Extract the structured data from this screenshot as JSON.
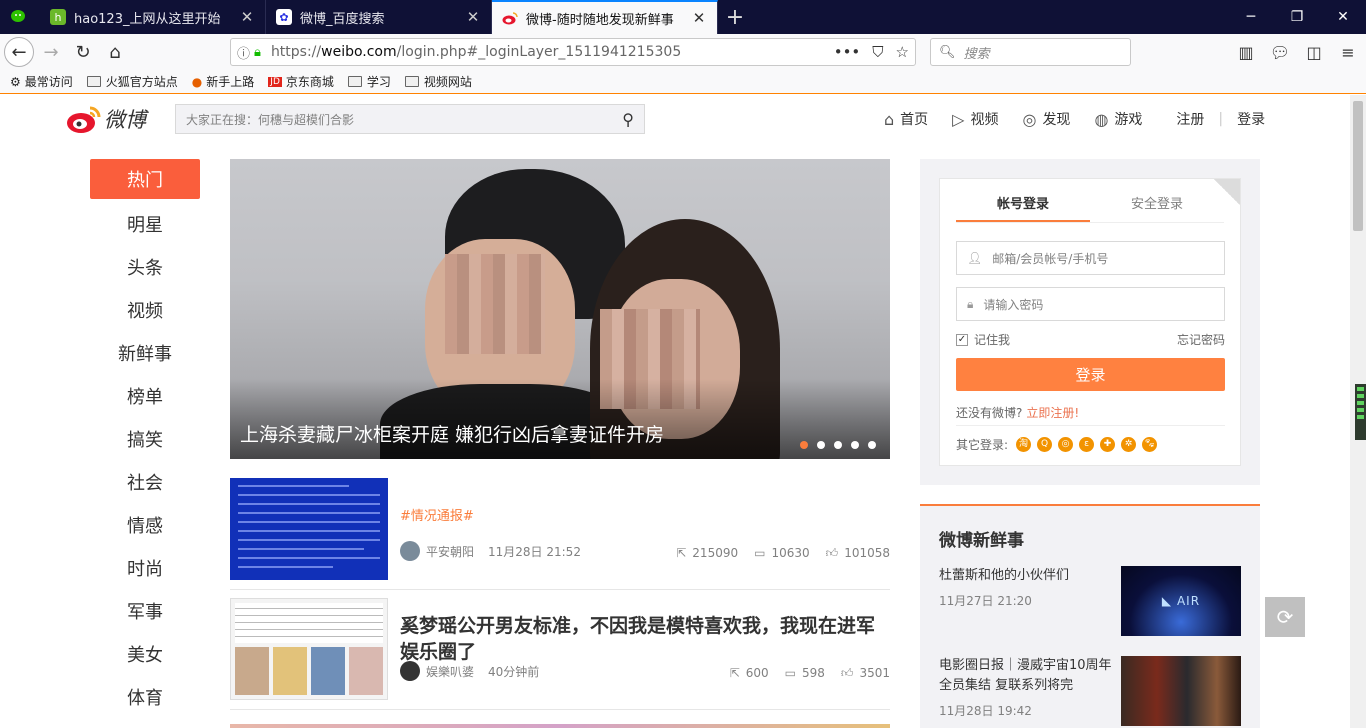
{
  "browser": {
    "tabs": [
      {
        "title": "hao123_上网从这里开始",
        "active": false
      },
      {
        "title": "微博_百度搜索",
        "active": false
      },
      {
        "title": "微博-随时随地发现新鲜事",
        "active": true
      }
    ],
    "url_prefix": "https://",
    "url_domain": "weibo.com",
    "url_path": "/login.php#_loginLayer_1511941215305",
    "search_placeholder": "搜索",
    "bookmarks": [
      "最常访问",
      "火狐官方站点",
      "新手上路",
      "京东商城",
      "学习",
      "视频网站"
    ]
  },
  "header": {
    "logo_text": "微博",
    "search_placeholder": "大家正在搜：何穗与超模们合影",
    "nav": [
      "首页",
      "视频",
      "发现",
      "游戏"
    ],
    "register": "注册",
    "login": "登录"
  },
  "left_nav": [
    "热门",
    "明星",
    "头条",
    "视频",
    "新鲜事",
    "榜单",
    "搞笑",
    "社会",
    "情感",
    "时尚",
    "军事",
    "美女",
    "体育"
  ],
  "hero": {
    "caption": "上海杀妻藏尸冰柜案开庭 嫌犯行凶后拿妻证件开房",
    "slides": 5,
    "active_slide": 0
  },
  "feed": [
    {
      "tag": "#情况通报#",
      "author": "平安朝阳",
      "time": "11月28日 21:52",
      "reposts": "215090",
      "comments": "10630",
      "likes": "101058"
    },
    {
      "headline": "奚梦瑶公开男友标准，不因我是模特喜欢我，我现在进军娱乐圈了",
      "author": "娱樂叭婆",
      "time": "40分钟前",
      "reposts": "600",
      "comments": "598",
      "likes": "3501"
    }
  ],
  "login": {
    "tab_account": "帐号登录",
    "tab_secure": "安全登录",
    "username_placeholder": "邮箱/会员帐号/手机号",
    "password_placeholder": "请输入密码",
    "remember": "记住我",
    "forgot": "忘记密码",
    "submit": "登录",
    "no_account": "还没有微博?",
    "register_now": "立即注册!",
    "other_login": "其它登录:"
  },
  "fresh": {
    "title": "微博新鲜事",
    "items": [
      {
        "title": "杜蕾斯和他的小伙伴们",
        "date": "11月27日 21:20"
      },
      {
        "title": "电影圈日报｜漫威宇宙10周年全员集结 复联系列将完",
        "date": "11月28日 19:42"
      }
    ]
  }
}
